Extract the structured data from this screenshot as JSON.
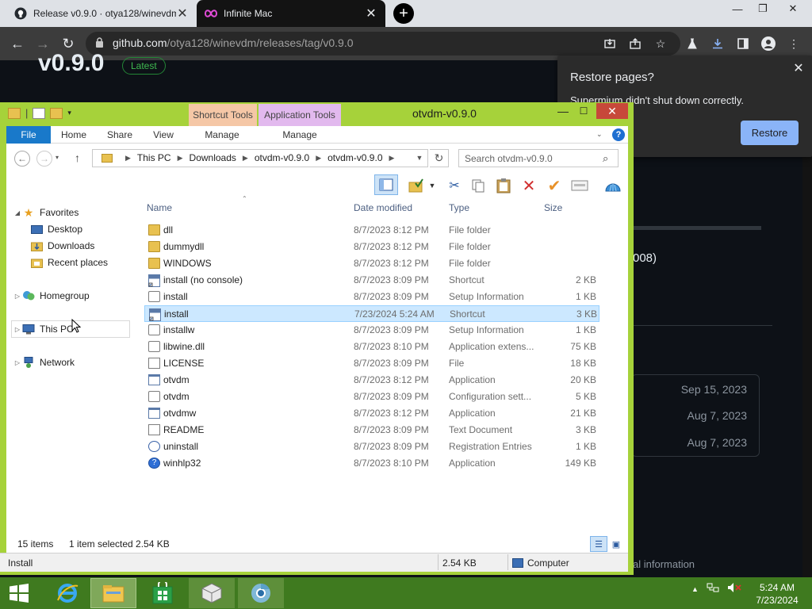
{
  "browser": {
    "tabs": [
      {
        "title": "Release v0.9.0 · otya128/winevdm",
        "close": "✕"
      },
      {
        "title": "Infinite Mac",
        "close": "✕"
      }
    ],
    "new_tab": "+",
    "window_controls": {
      "minimize": "—",
      "maximize": "❐",
      "close": "✕"
    },
    "nav": {
      "back": "←",
      "forward": "→",
      "reload": "↻"
    },
    "url": {
      "host": "github.com",
      "path": "/otya128/winevdm/releases/tag/v0.9.0"
    }
  },
  "github_page": {
    "title": "v0.9.0",
    "badge": "Latest",
    "fragment": "008)",
    "asset_dates": [
      "Sep 15, 2023",
      "Aug 7, 2023",
      "Aug 7, 2023"
    ],
    "footer_fragment": "al information"
  },
  "restore_popup": {
    "title": "Restore pages?",
    "message": "Supermium didn't shut down correctly.",
    "button": "Restore",
    "close": "✕"
  },
  "explorer": {
    "title": "otvdm-v0.9.0",
    "context_tabs": [
      "Shortcut Tools",
      "Application Tools"
    ],
    "ribbon_tabs": [
      "File",
      "Home",
      "Share",
      "View",
      "Manage",
      "Manage"
    ],
    "help": "?",
    "breadcrumb": [
      "This PC",
      "Downloads",
      "otvdm-v0.9.0",
      "otvdm-v0.9.0"
    ],
    "search_placeholder": "Search otvdm-v0.9.0",
    "nav_pane": {
      "favorites": "Favorites",
      "favorites_children": [
        "Desktop",
        "Downloads",
        "Recent places"
      ],
      "homegroup": "Homegroup",
      "this_pc": "This PC",
      "network": "Network"
    },
    "columns": [
      "Name",
      "Date modified",
      "Type",
      "Size"
    ],
    "files": [
      {
        "name": "dll",
        "date": "8/7/2023 8:12 PM",
        "type": "File folder",
        "size": "",
        "icon": "folder"
      },
      {
        "name": "dummydll",
        "date": "8/7/2023 8:12 PM",
        "type": "File folder",
        "size": "",
        "icon": "folder"
      },
      {
        "name": "WINDOWS",
        "date": "8/7/2023 8:12 PM",
        "type": "File folder",
        "size": "",
        "icon": "folder"
      },
      {
        "name": "install (no console)",
        "date": "8/7/2023 8:09 PM",
        "type": "Shortcut",
        "size": "2 KB",
        "icon": "shortcut"
      },
      {
        "name": "install",
        "date": "8/7/2023 8:09 PM",
        "type": "Setup Information",
        "size": "1 KB",
        "icon": "cfg"
      },
      {
        "name": "install",
        "date": "7/23/2024 5:24 AM",
        "type": "Shortcut",
        "size": "3 KB",
        "icon": "shortcut",
        "selected": true
      },
      {
        "name": "installw",
        "date": "8/7/2023 8:09 PM",
        "type": "Setup Information",
        "size": "1 KB",
        "icon": "cfg"
      },
      {
        "name": "libwine.dll",
        "date": "8/7/2023 8:10 PM",
        "type": "Application extens...",
        "size": "75 KB",
        "icon": "cfg"
      },
      {
        "name": "LICENSE",
        "date": "8/7/2023 8:09 PM",
        "type": "File",
        "size": "18 KB",
        "icon": "doc"
      },
      {
        "name": "otvdm",
        "date": "8/7/2023 8:12 PM",
        "type": "Application",
        "size": "20 KB",
        "icon": "app"
      },
      {
        "name": "otvdm",
        "date": "8/7/2023 8:09 PM",
        "type": "Configuration sett...",
        "size": "5 KB",
        "icon": "cfg"
      },
      {
        "name": "otvdmw",
        "date": "8/7/2023 8:12 PM",
        "type": "Application",
        "size": "21 KB",
        "icon": "app"
      },
      {
        "name": "README",
        "date": "8/7/2023 8:09 PM",
        "type": "Text Document",
        "size": "3 KB",
        "icon": "doc"
      },
      {
        "name": "uninstall",
        "date": "8/7/2023 8:09 PM",
        "type": "Registration Entries",
        "size": "1 KB",
        "icon": "reg"
      },
      {
        "name": "winhlp32",
        "date": "8/7/2023 8:10 PM",
        "type": "Application",
        "size": "149 KB",
        "icon": "help"
      }
    ],
    "status": {
      "items": "15 items",
      "selected": "1 item selected  2.54 KB",
      "bottom_left": "Install",
      "bottom_size": "2.54 KB",
      "bottom_location": "Computer"
    }
  },
  "taskbar": {
    "clock_time": "5:24 AM",
    "clock_date": "7/23/2024"
  }
}
